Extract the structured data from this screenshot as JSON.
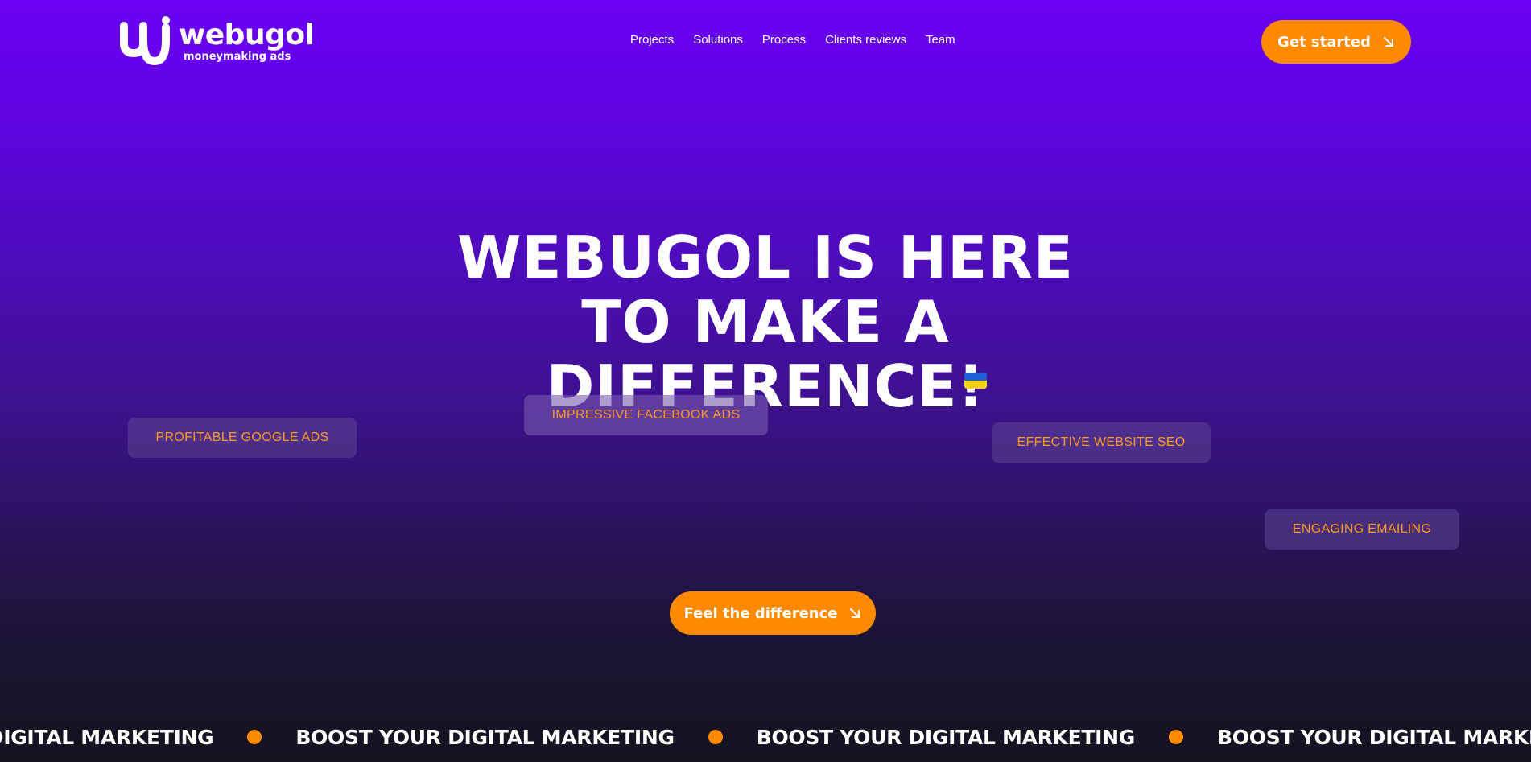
{
  "brand": {
    "name": "webugol",
    "tagline": "moneymaking ads",
    "accent_color": "#ff8a00",
    "background_top": "#6a00f4",
    "background_bottom": "#151320"
  },
  "nav": {
    "items": [
      {
        "label": "Projects"
      },
      {
        "label": "Solutions"
      },
      {
        "label": "Process"
      },
      {
        "label": "Clients reviews"
      },
      {
        "label": "Team"
      }
    ]
  },
  "header": {
    "cta_label": "Get started",
    "cta_icon": "arrow-down-right-icon"
  },
  "hero": {
    "title_lines": [
      "WEBUGOL IS HERE",
      "TO MAKE A",
      "DIFFERENCE!"
    ],
    "flag_icon": "ukraine-flag-icon",
    "tags": [
      {
        "label": "PROFITABLE GOOGLE ADS"
      },
      {
        "label": "IMPRESSIVE FACEBOOK ADS"
      },
      {
        "label": "EFFECTIVE WEBSITE SEO"
      },
      {
        "label": "ENGAGING EMAILING"
      }
    ],
    "cta_label": "Feel the difference",
    "cta_icon": "arrow-down-right-icon"
  },
  "marquee": {
    "text": "BOOST YOUR DIGITAL MARKETING",
    "separator_icon": "orange-dot-icon"
  }
}
